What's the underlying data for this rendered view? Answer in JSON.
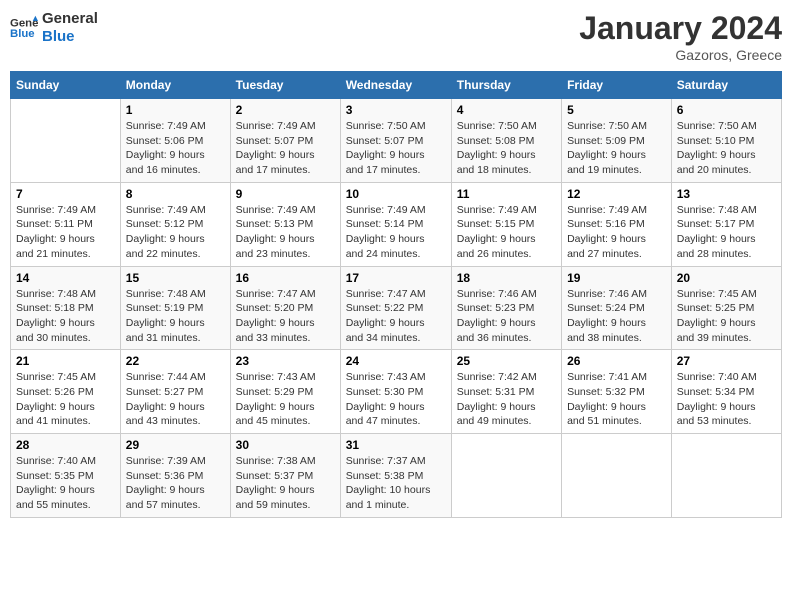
{
  "logo": {
    "line1": "General",
    "line2": "Blue"
  },
  "title": "January 2024",
  "location": "Gazoros, Greece",
  "days_of_week": [
    "Sunday",
    "Monday",
    "Tuesday",
    "Wednesday",
    "Thursday",
    "Friday",
    "Saturday"
  ],
  "weeks": [
    [
      {
        "day": "",
        "info": ""
      },
      {
        "day": "1",
        "info": "Sunrise: 7:49 AM\nSunset: 5:06 PM\nDaylight: 9 hours\nand 16 minutes."
      },
      {
        "day": "2",
        "info": "Sunrise: 7:49 AM\nSunset: 5:07 PM\nDaylight: 9 hours\nand 17 minutes."
      },
      {
        "day": "3",
        "info": "Sunrise: 7:50 AM\nSunset: 5:07 PM\nDaylight: 9 hours\nand 17 minutes."
      },
      {
        "day": "4",
        "info": "Sunrise: 7:50 AM\nSunset: 5:08 PM\nDaylight: 9 hours\nand 18 minutes."
      },
      {
        "day": "5",
        "info": "Sunrise: 7:50 AM\nSunset: 5:09 PM\nDaylight: 9 hours\nand 19 minutes."
      },
      {
        "day": "6",
        "info": "Sunrise: 7:50 AM\nSunset: 5:10 PM\nDaylight: 9 hours\nand 20 minutes."
      }
    ],
    [
      {
        "day": "7",
        "info": "Sunrise: 7:49 AM\nSunset: 5:11 PM\nDaylight: 9 hours\nand 21 minutes."
      },
      {
        "day": "8",
        "info": "Sunrise: 7:49 AM\nSunset: 5:12 PM\nDaylight: 9 hours\nand 22 minutes."
      },
      {
        "day": "9",
        "info": "Sunrise: 7:49 AM\nSunset: 5:13 PM\nDaylight: 9 hours\nand 23 minutes."
      },
      {
        "day": "10",
        "info": "Sunrise: 7:49 AM\nSunset: 5:14 PM\nDaylight: 9 hours\nand 24 minutes."
      },
      {
        "day": "11",
        "info": "Sunrise: 7:49 AM\nSunset: 5:15 PM\nDaylight: 9 hours\nand 26 minutes."
      },
      {
        "day": "12",
        "info": "Sunrise: 7:49 AM\nSunset: 5:16 PM\nDaylight: 9 hours\nand 27 minutes."
      },
      {
        "day": "13",
        "info": "Sunrise: 7:48 AM\nSunset: 5:17 PM\nDaylight: 9 hours\nand 28 minutes."
      }
    ],
    [
      {
        "day": "14",
        "info": "Sunrise: 7:48 AM\nSunset: 5:18 PM\nDaylight: 9 hours\nand 30 minutes."
      },
      {
        "day": "15",
        "info": "Sunrise: 7:48 AM\nSunset: 5:19 PM\nDaylight: 9 hours\nand 31 minutes."
      },
      {
        "day": "16",
        "info": "Sunrise: 7:47 AM\nSunset: 5:20 PM\nDaylight: 9 hours\nand 33 minutes."
      },
      {
        "day": "17",
        "info": "Sunrise: 7:47 AM\nSunset: 5:22 PM\nDaylight: 9 hours\nand 34 minutes."
      },
      {
        "day": "18",
        "info": "Sunrise: 7:46 AM\nSunset: 5:23 PM\nDaylight: 9 hours\nand 36 minutes."
      },
      {
        "day": "19",
        "info": "Sunrise: 7:46 AM\nSunset: 5:24 PM\nDaylight: 9 hours\nand 38 minutes."
      },
      {
        "day": "20",
        "info": "Sunrise: 7:45 AM\nSunset: 5:25 PM\nDaylight: 9 hours\nand 39 minutes."
      }
    ],
    [
      {
        "day": "21",
        "info": "Sunrise: 7:45 AM\nSunset: 5:26 PM\nDaylight: 9 hours\nand 41 minutes."
      },
      {
        "day": "22",
        "info": "Sunrise: 7:44 AM\nSunset: 5:27 PM\nDaylight: 9 hours\nand 43 minutes."
      },
      {
        "day": "23",
        "info": "Sunrise: 7:43 AM\nSunset: 5:29 PM\nDaylight: 9 hours\nand 45 minutes."
      },
      {
        "day": "24",
        "info": "Sunrise: 7:43 AM\nSunset: 5:30 PM\nDaylight: 9 hours\nand 47 minutes."
      },
      {
        "day": "25",
        "info": "Sunrise: 7:42 AM\nSunset: 5:31 PM\nDaylight: 9 hours\nand 49 minutes."
      },
      {
        "day": "26",
        "info": "Sunrise: 7:41 AM\nSunset: 5:32 PM\nDaylight: 9 hours\nand 51 minutes."
      },
      {
        "day": "27",
        "info": "Sunrise: 7:40 AM\nSunset: 5:34 PM\nDaylight: 9 hours\nand 53 minutes."
      }
    ],
    [
      {
        "day": "28",
        "info": "Sunrise: 7:40 AM\nSunset: 5:35 PM\nDaylight: 9 hours\nand 55 minutes."
      },
      {
        "day": "29",
        "info": "Sunrise: 7:39 AM\nSunset: 5:36 PM\nDaylight: 9 hours\nand 57 minutes."
      },
      {
        "day": "30",
        "info": "Sunrise: 7:38 AM\nSunset: 5:37 PM\nDaylight: 9 hours\nand 59 minutes."
      },
      {
        "day": "31",
        "info": "Sunrise: 7:37 AM\nSunset: 5:38 PM\nDaylight: 10 hours\nand 1 minute."
      },
      {
        "day": "",
        "info": ""
      },
      {
        "day": "",
        "info": ""
      },
      {
        "day": "",
        "info": ""
      }
    ]
  ]
}
